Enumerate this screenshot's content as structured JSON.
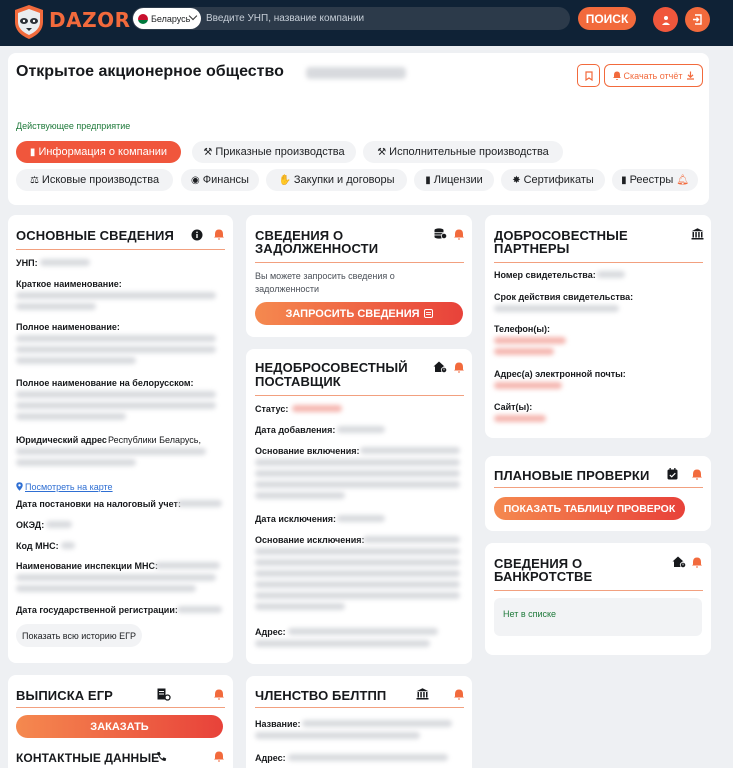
{
  "header": {
    "brand": "DAZOR",
    "country": "Беларусь",
    "search_placeholder": "Введите УНП, название компании",
    "search_button": "ПОИСК",
    "logo_icon": "raccoon-shield-logo",
    "user_icon": "user-icon",
    "login_icon": "login-icon",
    "accent": "#f26a3c",
    "bg": "#0f2236"
  },
  "company": {
    "title": "Открытое акционерное общество",
    "download_label": "Скачать отчёт",
    "status": "Действующее предприятие",
    "tabs": [
      {
        "label": "Информация о компании",
        "icon": "document-icon",
        "active": true
      },
      {
        "label": "Приказные производства",
        "icon": "hammer-icon"
      },
      {
        "label": "Исполнительные производства",
        "icon": "hammer-icon"
      },
      {
        "label": "Исковые производства",
        "icon": "scales-icon"
      },
      {
        "label": "Финансы",
        "icon": "coins-icon"
      },
      {
        "label": "Закупки и договоры",
        "icon": "handshake-icon"
      },
      {
        "label": "Лицензии",
        "icon": "document-icon"
      },
      {
        "label": "Сертификаты",
        "icon": "badge-icon"
      },
      {
        "label": "Реестры",
        "icon": "document-icon"
      }
    ]
  },
  "basic": {
    "title": "ОСНОВНЫЕ СВЕДЕНИЯ",
    "unp": "УНП:",
    "short_name": "Краткое наименование:",
    "full_name": "Полное наименование:",
    "full_name_by": "Полное наименование на белорусском:",
    "legal_address": "Юридический адрес",
    "legal_address_value": "Республики Беларусь,",
    "map_link": "Посмотреть на карте",
    "tax_date": "Дата постановки на налоговый учет:",
    "okved": "ОКЭД:",
    "mns_code": "Код МНС:",
    "mns_name": "Наименование инспекции МНС:",
    "reg_date": "Дата государственной регистрации:",
    "history_button": "Показать всю историю ЕГР"
  },
  "egr": {
    "title": "ВЫПИСКА ЕГР",
    "order_button": "ЗАКАЗАТЬ",
    "contacts_title": "КОНТАКТНЫЕ ДАННЫЕ"
  },
  "debt": {
    "title_line1": "СВЕДЕНИЯ О",
    "title_line2": "ЗАДОЛЖЕННОСТИ",
    "text": "Вы можете запросить сведения о задолженности",
    "button": "ЗАПРОСИТЬ СВЕДЕНИЯ"
  },
  "bad_supplier": {
    "title_line1": "НЕДОБРОСОВЕСТНЫЙ",
    "title_line2": "ПОСТАВЩИК",
    "status": "Статус:",
    "added": "Дата добавления:",
    "reason_in": "Основание включения:",
    "excluded": "Дата исключения:",
    "reason_out": "Основание исключения:",
    "address": "Адрес:"
  },
  "beltpp": {
    "title": "ЧЛЕНСТВО БЕЛТПП",
    "name": "Название:",
    "address": "Адрес:"
  },
  "partners": {
    "title_line1": "ДОБРОСОВЕСТНЫЕ",
    "title_line2": "ПАРТНЕРЫ",
    "cert_no": "Номер свидетельства:",
    "cert_term": "Срок действия свидетельства:",
    "phone": "Телефон(ы):",
    "email": "Адрес(а) электронной почты:",
    "site": "Сайт(ы):"
  },
  "inspections": {
    "title": "ПЛАНОВЫЕ ПРОВЕРКИ",
    "button": "ПОКАЗАТЬ ТАБЛИЦУ ПРОВЕРОК"
  },
  "bankruptcy": {
    "title_line1": "СВЕДЕНИЯ О",
    "title_line2": "БАНКРОТСТВЕ",
    "note": "Нет в списке"
  }
}
